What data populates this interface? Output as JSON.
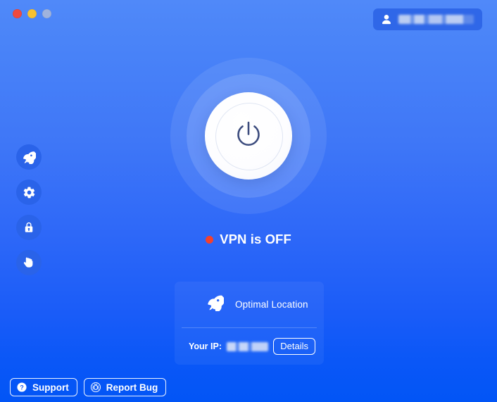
{
  "window": {
    "traffic_lights": [
      {
        "name": "close",
        "color": "#f04a3f"
      },
      {
        "name": "minimize",
        "color": "#f8c230"
      },
      {
        "name": "zoom",
        "color": "#9fb3dd"
      }
    ]
  },
  "header": {
    "account": {
      "icon": "person-icon",
      "username_redacted": true,
      "username": ""
    }
  },
  "sidebar": {
    "items": [
      {
        "name": "sidebar-item-optimal-location",
        "icon": "rocket-icon"
      },
      {
        "name": "sidebar-item-settings",
        "icon": "gear-icon"
      },
      {
        "name": "sidebar-item-security",
        "icon": "lock-icon"
      },
      {
        "name": "sidebar-item-block",
        "icon": "hand-icon"
      }
    ]
  },
  "main": {
    "power_button": {
      "icon": "power-icon",
      "state": "off"
    },
    "status": {
      "dot_color": "#f4402d",
      "text": "VPN is OFF"
    },
    "location_card": {
      "icon": "rocket-icon",
      "location_label": "Optimal Location",
      "ip_label": "Your IP:",
      "ip_value": "",
      "ip_redacted": true,
      "details_label": "Details"
    }
  },
  "footer": {
    "buttons": [
      {
        "label": "Support",
        "icon": "question-circle-icon"
      },
      {
        "label": "Report Bug",
        "icon": "bug-icon"
      }
    ]
  },
  "colors": {
    "background_top": "#5089f9",
    "background_bottom": "#0255f6",
    "accent": "#2f67e8",
    "status_off": "#f4402d",
    "text": "#ffffff",
    "power_glyph": "#3b4b7d"
  }
}
